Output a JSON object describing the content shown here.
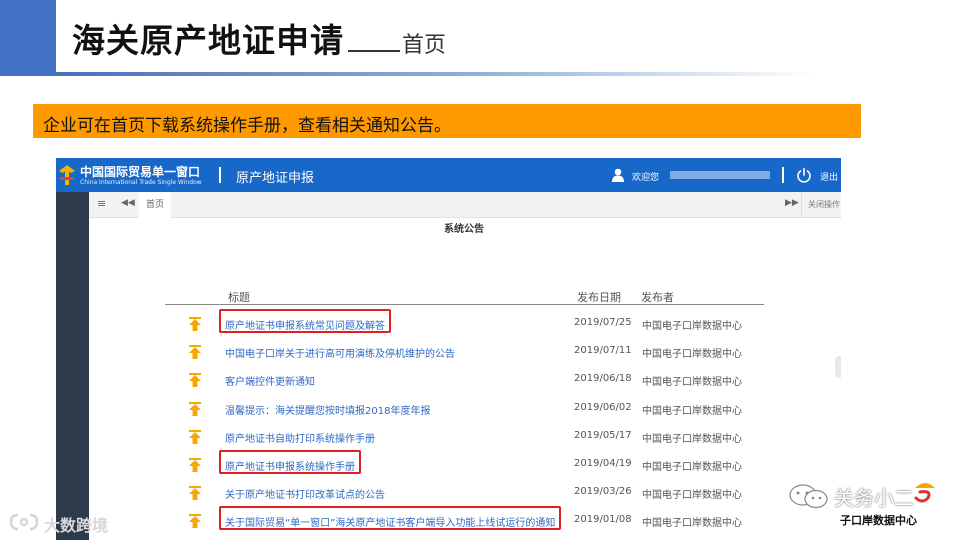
{
  "slide": {
    "title": "海关原产地证申请",
    "subtitle": "首页",
    "banner": "企业可在首页下载系统操作手册，查看相关通知公告。"
  },
  "app": {
    "logo_cn": "中国国际贸易单一窗口",
    "logo_en": "China International Trade Single Window",
    "name": "原产地证申报",
    "welcome": "欢迎您",
    "logout": "退出"
  },
  "tabs": {
    "home": "首页",
    "close_ops": "关闭操作"
  },
  "notice": {
    "title": "系统公告",
    "columns": {
      "title": "标题",
      "date": "发布日期",
      "publisher": "发布者"
    },
    "rows": [
      {
        "title": "原产地证书申报系统常见问题及解答",
        "date": "2019/07/25",
        "publisher": "中国电子口岸数据中心",
        "highlighted": true
      },
      {
        "title": "中国电子口岸关于进行高可用演练及停机维护的公告",
        "date": "2019/07/11",
        "publisher": "中国电子口岸数据中心",
        "highlighted": false
      },
      {
        "title": "客户端控件更新通知",
        "date": "2019/06/18",
        "publisher": "中国电子口岸数据中心",
        "highlighted": false
      },
      {
        "title": "温馨提示：海关提醒您按时填报2018年度年报",
        "date": "2019/06/02",
        "publisher": "中国电子口岸数据中心",
        "highlighted": false
      },
      {
        "title": "原产地证书自助打印系统操作手册",
        "date": "2019/05/17",
        "publisher": "中国电子口岸数据中心",
        "highlighted": false
      },
      {
        "title": "原产地证书申报系统操作手册",
        "date": "2019/04/19",
        "publisher": "中国电子口岸数据中心",
        "highlighted": true
      },
      {
        "title": "关于原产地证书打印改革试点的公告",
        "date": "2019/03/26",
        "publisher": "中国电子口岸数据中心",
        "highlighted": false
      },
      {
        "title": "关于国际贸易“单一窗口”海关原产地证书客户端导入功能上线试运行的通知",
        "date": "2019/01/08",
        "publisher": "中国电子口岸数据中心",
        "highlighted": true
      }
    ]
  },
  "watermarks": {
    "left": "大数跨境",
    "right_name": "关务小二",
    "right_sub": "子口岸数据中心"
  },
  "colors": {
    "brand_blue": "#1768c9",
    "banner_orange": "#ff9900",
    "highlight_red": "#e02020",
    "link_blue": "#2f68c5",
    "arrow_orange": "#f5a800"
  }
}
